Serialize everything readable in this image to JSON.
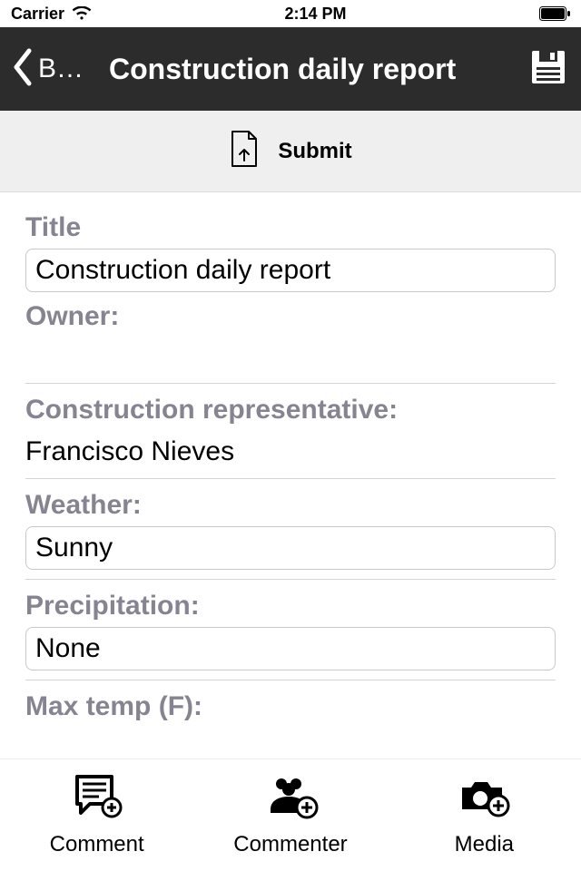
{
  "status": {
    "carrier": "Carrier",
    "time": "2:14 PM"
  },
  "nav": {
    "back": "B…",
    "title": "Construction daily report"
  },
  "submit": {
    "label": "Submit"
  },
  "form": {
    "title_label": "Title",
    "title_value": "Construction daily report",
    "owner_label": "Owner:",
    "rep_label": "Construction representative:",
    "rep_value": "Francisco Nieves",
    "weather_label": "Weather:",
    "weather_value": "Sunny",
    "precip_label": "Precipitation:",
    "precip_value": "None",
    "maxtemp_label": "Max temp (F):"
  },
  "bottom": {
    "comment": "Comment",
    "commenter": "Commenter",
    "media": "Media"
  }
}
